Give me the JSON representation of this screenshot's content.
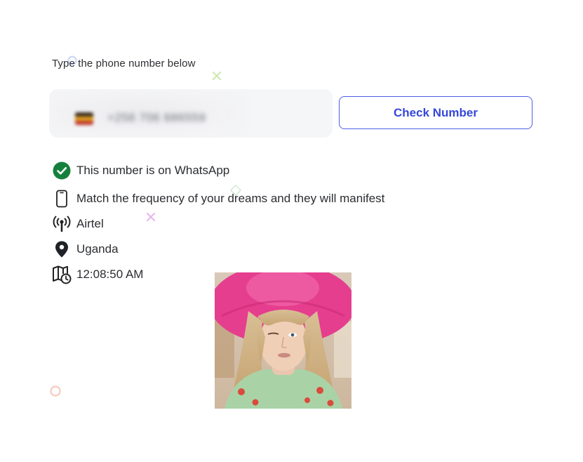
{
  "form": {
    "prompt": "Type the phone number below",
    "phone_value": "+256 706 686559",
    "check_button_label": "Check Number"
  },
  "result": {
    "whatsapp_status": "This number is on WhatsApp",
    "about": "Match the frequency of your dreams and they will manifest",
    "carrier": "Airtel",
    "country": "Uganda",
    "local_time": "12:08:50 AM"
  },
  "icons": {
    "whatsapp_status": "check-circle-icon",
    "about": "phone-icon",
    "carrier": "signal-tower-icon",
    "country": "location-pin-icon",
    "local_time": "map-clock-icon"
  },
  "colors": {
    "accent": "#3547d9",
    "success": "#16a34a",
    "hat": "#e8408f"
  }
}
